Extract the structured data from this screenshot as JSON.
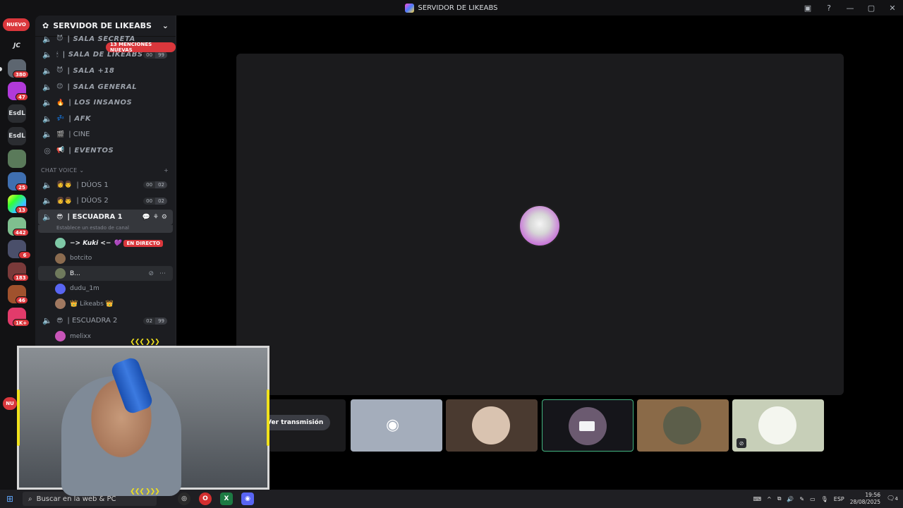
{
  "window": {
    "title": "SERVIDOR DE LIKEABS",
    "controls": [
      "—",
      "▢",
      "✕"
    ]
  },
  "rail": {
    "new_pill": "NUEVO",
    "new_pill_bottom": "NU",
    "servers": [
      {
        "label": "JC",
        "badge": ""
      },
      {
        "label": "",
        "badge": "380"
      },
      {
        "label": "",
        "badge": "47"
      },
      {
        "label": "EsdL",
        "badge": ""
      },
      {
        "label": "EsdL",
        "badge": ""
      },
      {
        "label": "",
        "badge": ""
      },
      {
        "label": "",
        "badge": "25"
      },
      {
        "label": "",
        "badge": "13"
      },
      {
        "label": "",
        "badge": "442"
      },
      {
        "label": "",
        "badge": "6"
      },
      {
        "label": "",
        "badge": "183"
      },
      {
        "label": "",
        "badge": "46"
      },
      {
        "label": "",
        "badge": "1K+"
      }
    ]
  },
  "sidebar": {
    "server_name": "SERVIDOR DE LIKEABS",
    "mentions_pill": "13 MENCIONES NUEVAS",
    "channels_top": [
      {
        "emoji": "😈",
        "name": "| SALA SECRETA",
        "style": "italic"
      },
      {
        "emoji": "🕯",
        "name": "| SALA DE LIKEABS",
        "style": "italic",
        "count": [
          "00",
          "99"
        ]
      },
      {
        "emoji": "😈",
        "name": "| SALA +18",
        "style": "italic"
      },
      {
        "emoji": "😊",
        "name": "| SALA GENERAL",
        "style": "italic"
      },
      {
        "emoji": "🔥",
        "name": "| LOS INSANOS",
        "style": "italic"
      },
      {
        "emoji": "💤",
        "name": "| AFK",
        "style": "italic"
      },
      {
        "emoji": "🎬",
        "name": "| CINE",
        "style": "plain"
      },
      {
        "emoji": "📢",
        "name": "| EVENTOS",
        "style": "italic"
      }
    ],
    "category": "CHAT VOICE",
    "channels_voice": [
      {
        "emoji": "👩👨",
        "name": "| DÚOS 1",
        "count": [
          "00",
          "02"
        ]
      },
      {
        "emoji": "👩👨",
        "name": "| DÚOS 2",
        "count": [
          "00",
          "02"
        ]
      }
    ],
    "active_channel": {
      "emoji": "😎",
      "name": "| ESCUADRA 1",
      "status_hint": "Establece un estado de canal"
    },
    "members": [
      {
        "name": "−> Kuki <− 💜",
        "live": "EN DIRECTO",
        "color": "#7ec8a6"
      },
      {
        "name": "botcito",
        "color": "#8b6b4f"
      },
      {
        "name": "B...",
        "color": "#6f7a5c"
      },
      {
        "name": "dudu_1m",
        "color": "#5865f2"
      },
      {
        "name": "👑 Likeabs 👑",
        "color": "#a07860"
      }
    ],
    "escuadra2": {
      "emoji": "😎",
      "name": "| ESCUADRA 2",
      "count": [
        "02",
        "99"
      ]
    },
    "escuadra2_members": [
      {
        "name": "melixx",
        "color": "#c855b8"
      }
    ]
  },
  "stage": {
    "watch_button": "Ver transmisión",
    "tiles": [
      {
        "kind": "watch",
        "bg": "#1b1b1d"
      },
      {
        "kind": "discord",
        "bg": "#a4adbb"
      },
      {
        "kind": "avatar",
        "bg": "#4a3a30",
        "avatar": "#d9c3b0"
      },
      {
        "kind": "camera",
        "bg": "#15151a",
        "avatar": "#6b5a70",
        "border": "#43b581"
      },
      {
        "kind": "avatar",
        "bg": "#8a6a48",
        "avatar": "#5c5e4a"
      },
      {
        "kind": "muted",
        "bg": "#c7cfb8",
        "avatar": "#f4f6ef"
      }
    ]
  },
  "webcam": {
    "chevrons": "❮❮❮ ❯❯❯"
  },
  "taskbar": {
    "search_placeholder": "Buscar en la web & PC",
    "lang": "ESP",
    "time": "19:56",
    "date": "28/08/2025",
    "notifications": "4"
  }
}
